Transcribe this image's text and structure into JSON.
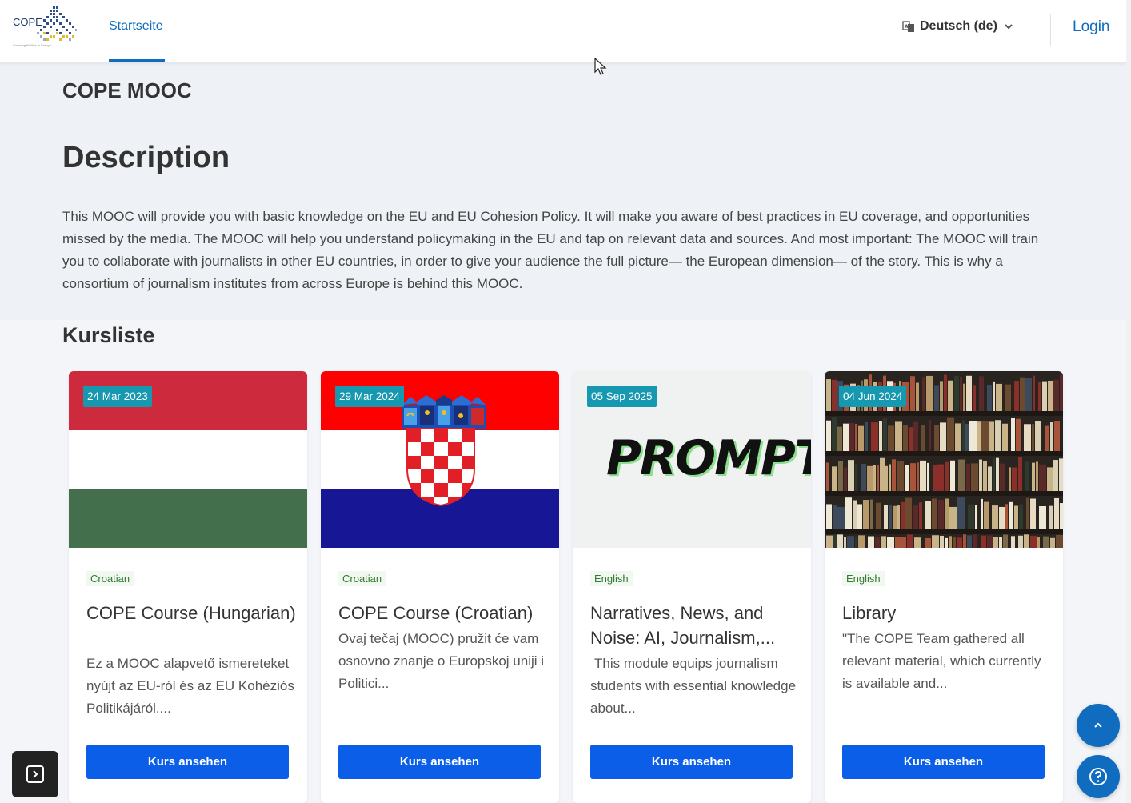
{
  "header": {
    "logo_text": "COPE",
    "logo_sub": "Covering Politics in Europe",
    "nav_item": "Startseite",
    "language": "Deutsch (de)",
    "login": "Login"
  },
  "page": {
    "title": "COPE MOOC",
    "description_heading": "Description",
    "description": "This MOOC will provide you with basic knowledge on the EU and EU Cohesion Policy. It will make you aware of best practices in EU coverage, and opportunities missed by the media. The MOOC will help you understand policymaking in the EU and tap on relevant data and sources. And most important: The MOOC will train you to collaborate with journalists in other EU countries, in order to give your audience the full picture— the European dimension— of the story. This is why a consortium of journalism institutes from across Europe is behind this MOOC.",
    "course_list_heading": "Kursliste"
  },
  "courses": [
    {
      "date": "24 Mar 2023",
      "language": "Croatian",
      "title": "COPE Course (Hungarian)",
      "description": "Ez a MOOC alapvető ismereteket nyújt az EU-ról és az EU Kohéziós Politikájáról....",
      "button": "Kurs ansehen"
    },
    {
      "date": "29 Mar 2024",
      "language": "Croatian",
      "title": "COPE Course (Croatian)",
      "description": "Ovaj tečaj (MOOC) pružit će vam osnovno znanje o Europskoj uniji i Politici...",
      "button": "Kurs ansehen"
    },
    {
      "date": "05 Sep 2025",
      "language": "English",
      "title": "Narratives, News, and Noise: AI, Journalism,...",
      "image_text": "PROMPT",
      "description": "This module equips journalism students with essential knowledge about...",
      "button": "Kurs ansehen"
    },
    {
      "date": "04 Jun 2024",
      "language": "English",
      "title": "Library",
      "description": "\"The COPE Team gathered all relevant material, which currently is available and...",
      "button": "Kurs ansehen"
    }
  ],
  "colors": {
    "primary": "#0f6cbf",
    "button": "#0b5ee8",
    "badge": "#1698b0",
    "lang_tag_text": "#357a32"
  },
  "icons": {
    "language": "language-icon",
    "chevron": "chevron-down-icon",
    "scroll_top": "chevron-up-icon",
    "help": "question-icon",
    "drawer": "drawer-toggle-icon"
  }
}
